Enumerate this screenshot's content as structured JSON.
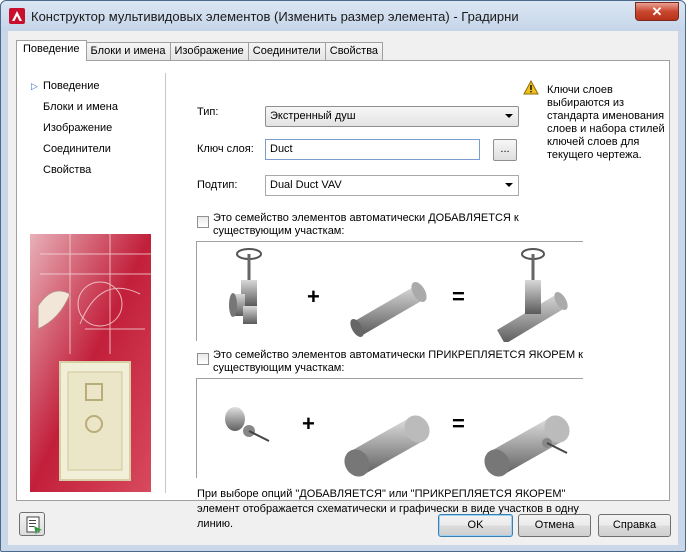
{
  "window": {
    "title": "Конструктор мультивидовых элементов (Изменить размер элемента) - Градирни",
    "close_label": "✕"
  },
  "tabs": [
    {
      "label": "Поведение",
      "active": true
    },
    {
      "label": "Блоки и имена",
      "active": false
    },
    {
      "label": "Изображение",
      "active": false
    },
    {
      "label": "Соединители",
      "active": false
    },
    {
      "label": "Свойства",
      "active": false
    }
  ],
  "nav": [
    {
      "label": "Поведение",
      "selected": true
    },
    {
      "label": "Блоки и имена",
      "selected": false
    },
    {
      "label": "Изображение",
      "selected": false
    },
    {
      "label": "Соединители",
      "selected": false
    },
    {
      "label": "Свойства",
      "selected": false
    }
  ],
  "form": {
    "type_label": "Тип:",
    "type_value": "Экстренный душ",
    "layer_key_label": "Ключ слоя:",
    "layer_key_value": "Duct",
    "browse_label": "...",
    "subtype_label": "Подтип:",
    "subtype_value": "Dual Duct VAV"
  },
  "info": {
    "icon": "warning-icon",
    "text": "Ключи слоев выбираются из стандарта именования слоев и набора стилей ключей слоев для текущего чертежа."
  },
  "options": {
    "add_checkbox": {
      "checked": false,
      "label": "Это семейство элементов автоматически ДОБАВЛЯЕТСЯ к существующим участкам:"
    },
    "anchor_checkbox": {
      "checked": false,
      "label": "Это семейство элементов автоматически ПРИКРЕПЛЯЕТСЯ ЯКОРЕМ к существующим участкам:"
    },
    "plus": "+",
    "equals": "="
  },
  "note": "При выборе опций \"ДОБАВЛЯЕТСЯ\" или \"ПРИКРЕПЛЯЕТСЯ ЯКОРЕМ\" элемент отображается схематически и графически в виде участков в одну линию.",
  "buttons": {
    "ok": "OK",
    "cancel": "Отмена",
    "help": "Справка"
  },
  "colors": {
    "accent": "#3c7fb1",
    "sidebar_art": "#c21f3a",
    "warning": "#f2c01e"
  }
}
